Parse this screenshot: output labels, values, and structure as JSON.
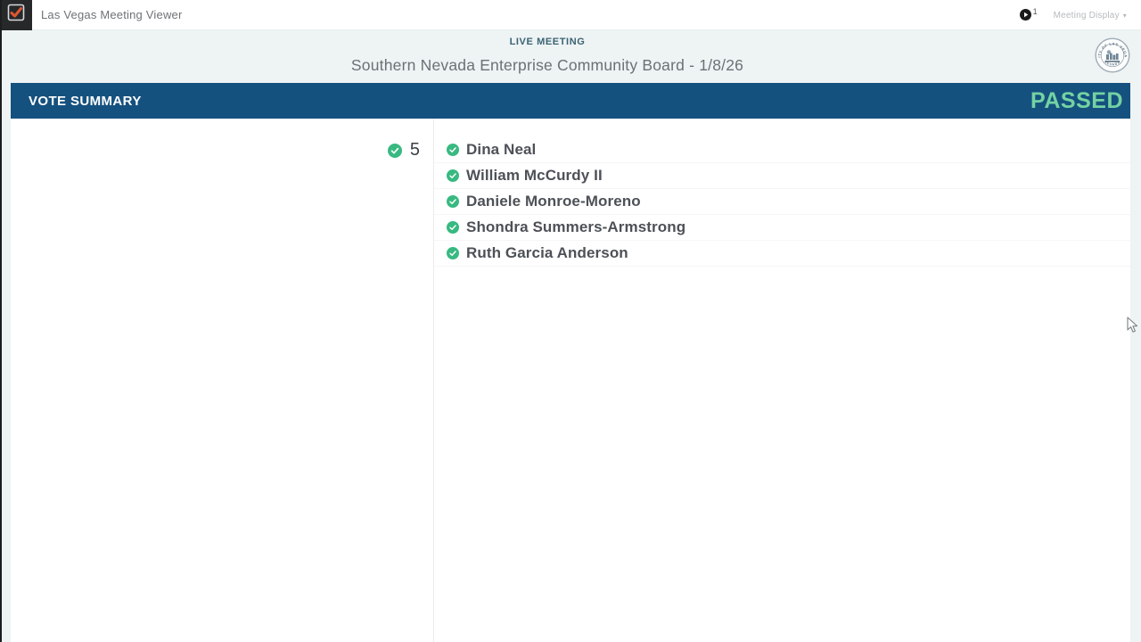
{
  "app_header": {
    "title": "Las Vegas Meeting Viewer",
    "viewer_count": "1",
    "display_selector_label": "Meeting Display",
    "display_selector_caret": "▾"
  },
  "meeting": {
    "live_badge": "LIVE MEETING",
    "title": "Southern Nevada Enterprise Community Board - 1/8/26",
    "seal_name": "city-of-las-vegas-seal"
  },
  "vote_summary": {
    "header_label": "VOTE SUMMARY",
    "result": "PASSED",
    "yes_count": "5",
    "voters": [
      "Dina Neal",
      "William McCurdy II",
      "Daniele Monroe-Moreno",
      "Shondra Summers-Armstrong",
      "Ruth Garcia Anderson"
    ]
  },
  "colors": {
    "header_blue": "#15517f",
    "passed_green": "#73d2a2",
    "check_green": "#38b981",
    "live_teal": "#3a6372",
    "logo_check_orange": "#df5630"
  }
}
